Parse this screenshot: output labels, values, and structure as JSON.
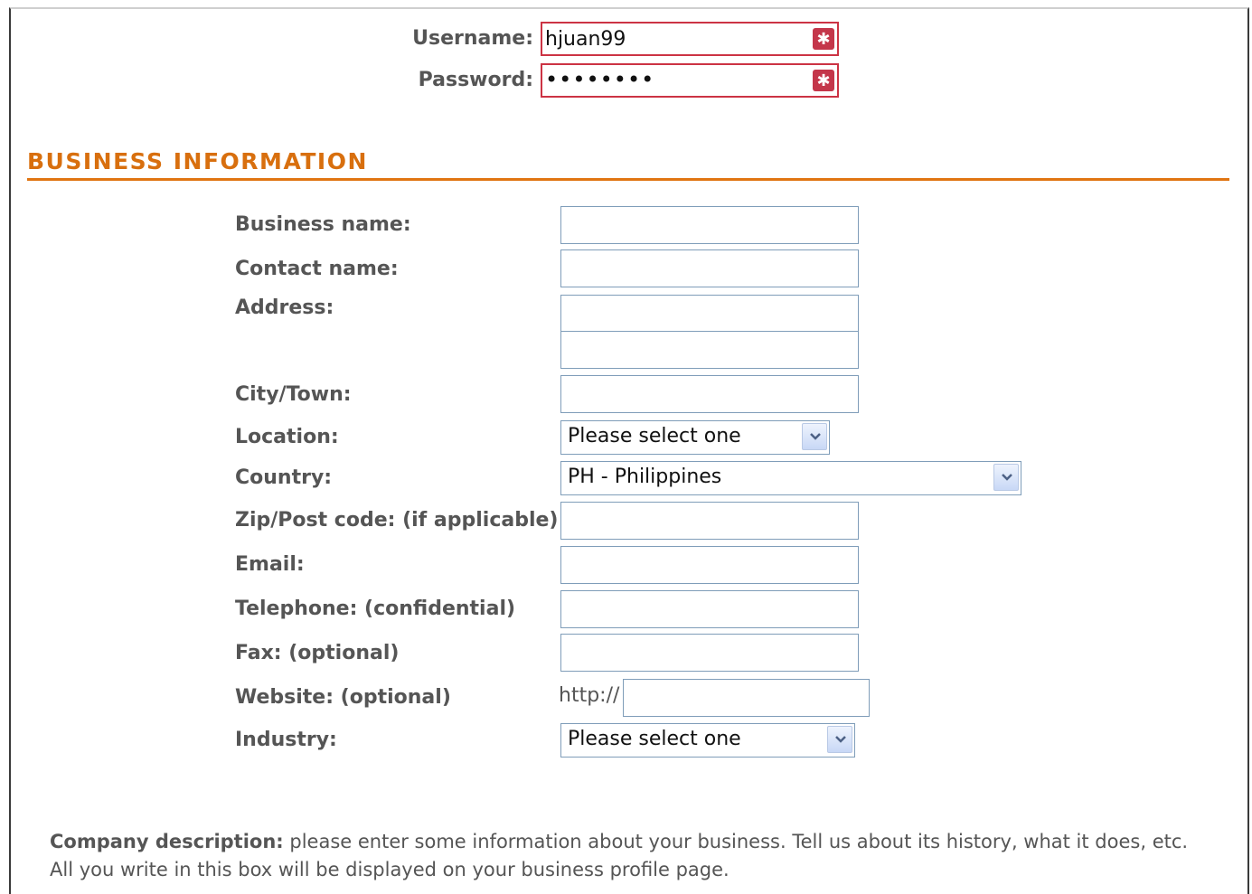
{
  "login": {
    "username_label": "Username:",
    "username_value": "hjuan99",
    "password_label": "Password:",
    "password_value": "••••••••",
    "required_icon": "required-asterisk-icon"
  },
  "section": {
    "title": "BUSINESS INFORMATION",
    "accent_color": "#e07512"
  },
  "fields": {
    "business_name": "Business name:",
    "contact_name": "Contact name:",
    "address": "Address:",
    "city": "City/Town:",
    "location": "Location:",
    "location_value": "Please select one",
    "country": "Country:",
    "country_value": "PH - Philippines",
    "zip": "Zip/Post code: (if applicable)",
    "email": "Email:",
    "telephone": "Telephone: (confidential)",
    "fax": "Fax: (optional)",
    "website": "Website: (optional)",
    "website_prefix": "http://",
    "industry": "Industry:",
    "industry_value": "Please select one"
  },
  "description": {
    "label": "Company description:",
    "text": " please enter some information about your business. Tell us about its history, what it does, etc. All you write in this box will be displayed on your business profile page."
  }
}
